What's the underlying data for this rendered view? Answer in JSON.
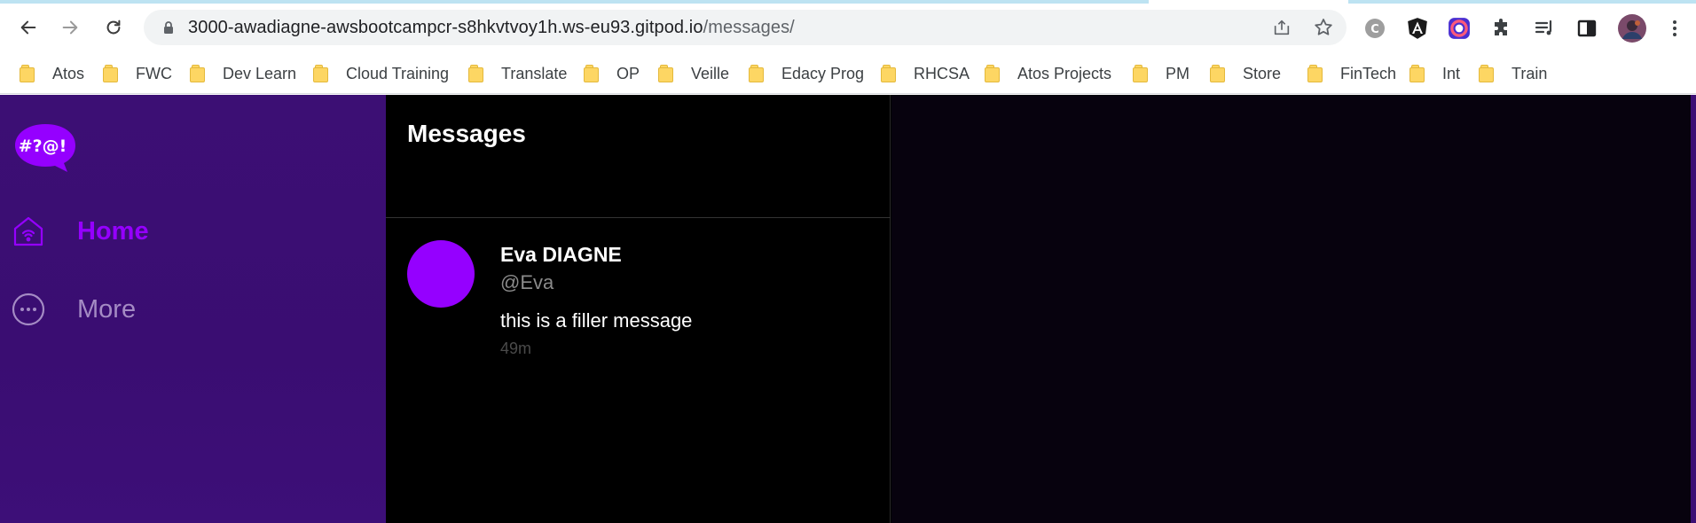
{
  "browser": {
    "url_host": "3000-awadiagne-awsbootcampcr-s8hkvtvoy1h.ws-eu93.gitpod.io",
    "url_path": "/messages/",
    "back_icon": "arrow-left-icon",
    "forward_icon": "arrow-right-icon",
    "reload_icon": "reload-icon",
    "extensions": [
      "c-extension-icon",
      "angular-icon",
      "color-picker-icon",
      "puzzle-icon",
      "reading-list-icon",
      "side-panel-icon",
      "profile-avatar",
      "kebab-menu-icon"
    ]
  },
  "bookmarks": [
    {
      "label": "Atos"
    },
    {
      "label": "FWC"
    },
    {
      "label": "Dev Learn"
    },
    {
      "label": "Cloud Training"
    },
    {
      "label": "Translate"
    },
    {
      "label": "OP"
    },
    {
      "label": "Veille"
    },
    {
      "label": "Edacy Prog"
    },
    {
      "label": "RHCSA"
    },
    {
      "label": "Atos Projects"
    },
    {
      "label": "PM"
    },
    {
      "label": "Store"
    },
    {
      "label": "FinTech"
    },
    {
      "label": "Int"
    },
    {
      "label": "Train"
    }
  ],
  "app": {
    "logo_text": "#?@!",
    "nav": [
      {
        "label": "Home",
        "icon": "home-icon",
        "active": true
      },
      {
        "label": "More",
        "icon": "more-icon",
        "active": false
      }
    ],
    "feed": {
      "title": "Messages",
      "messages": [
        {
          "name": "Eva DIAGNE",
          "handle": "@Eva",
          "body": "this is a filler message",
          "time": "49m"
        }
      ]
    }
  },
  "colors": {
    "accent": "#9500ff",
    "sidebar": "#3c0f74",
    "feed_bg": "#000000",
    "detail_bg": "#07020e"
  }
}
